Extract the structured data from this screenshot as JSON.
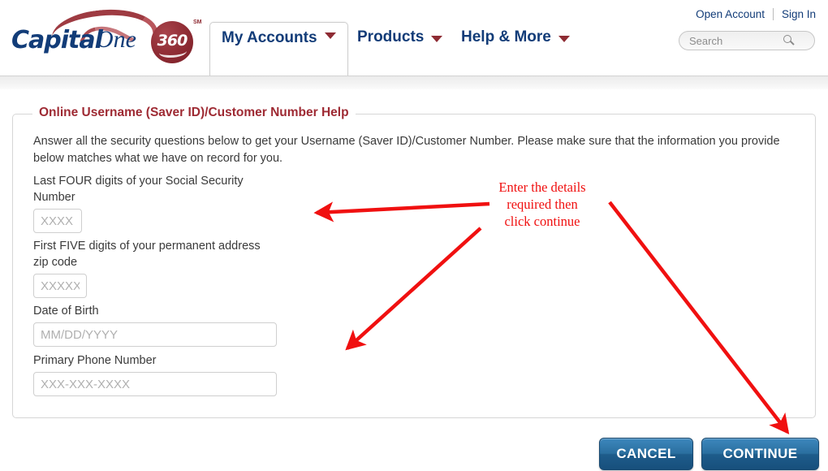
{
  "header": {
    "logo": {
      "brand_primary": "Capital",
      "brand_secondary": "One",
      "badge": "360",
      "trademark": "SM",
      "brand_blue": "#123c78",
      "brand_red": "#8e2b33"
    },
    "nav": [
      {
        "label": "My Accounts",
        "active": true,
        "icon": "chevron-down-icon"
      },
      {
        "label": "Products",
        "active": false,
        "icon": "chevron-down-icon"
      },
      {
        "label": "Help & More",
        "active": false,
        "icon": "chevron-down-icon"
      }
    ],
    "top_links": [
      {
        "label": "Open Account"
      },
      {
        "label": "Sign In"
      }
    ],
    "search": {
      "placeholder": "Search",
      "value": "",
      "icon": "search-icon"
    }
  },
  "form": {
    "legend": "Online Username (Saver ID)/Customer Number Help",
    "intro": "Answer all the security questions below to get your Username (Saver ID)/Customer Number. Please make sure that the information you provide below matches what we have on record for you.",
    "fields": [
      {
        "label": "Last FOUR digits of your Social Security Number",
        "placeholder": "XXXX",
        "value": "",
        "name": "ssn-last-four-field"
      },
      {
        "label": "First FIVE digits of your permanent address zip code",
        "placeholder": "XXXXX",
        "value": "",
        "name": "zip-code-field"
      },
      {
        "label": "Date of Birth",
        "placeholder": "MM/DD/YYYY",
        "value": "",
        "name": "date-of-birth-field"
      },
      {
        "label": "Primary Phone Number",
        "placeholder": "XXX-XXX-XXXX",
        "value": "",
        "name": "primary-phone-field"
      }
    ]
  },
  "actions": {
    "cancel_label": "CANCEL",
    "continue_label": "CONTINUE",
    "button_color": "#1e5c8b"
  },
  "annotation": {
    "line1": "Enter the details",
    "line2": "required then",
    "line3": "click continue",
    "color": "#f01010",
    "arrows": [
      {
        "name": "arrow-to-ssn-field",
        "from": [
          603,
          251
        ],
        "to": [
          386,
          262
        ]
      },
      {
        "name": "arrow-to-dob-field",
        "from": [
          592,
          281
        ],
        "to": [
          424,
          433
        ]
      },
      {
        "name": "arrow-to-continue",
        "from": [
          751,
          249
        ],
        "to": [
          974,
          536
        ]
      }
    ]
  }
}
